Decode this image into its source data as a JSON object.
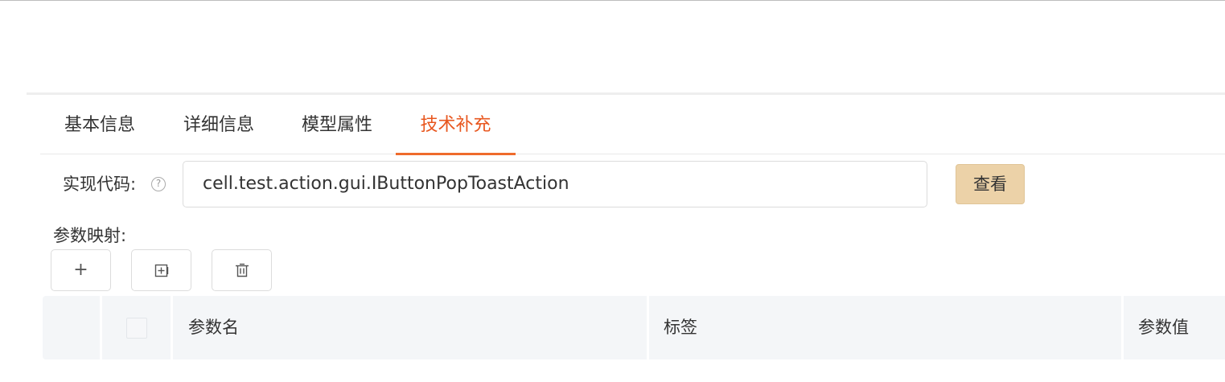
{
  "tabs": [
    {
      "label": "基本信息",
      "active": false
    },
    {
      "label": "详细信息",
      "active": false
    },
    {
      "label": "模型属性",
      "active": false
    },
    {
      "label": "技术补充",
      "active": true
    }
  ],
  "implementation": {
    "label": "实现代码:",
    "help_icon": "question-circle-icon",
    "value": "cell.test.action.gui.IButtonPopToastAction",
    "view_button": "查看"
  },
  "param_mapping": {
    "label": "参数映射:",
    "toolbar": {
      "add_label": "+",
      "add_icon": "plus-icon",
      "expand_icon": "plus-square-icon",
      "delete_icon": "trash-icon"
    },
    "table": {
      "columns": [
        "参数名",
        "标签",
        "参数值"
      ]
    }
  },
  "colors": {
    "accent": "#e8571f",
    "view_button_bg": "#ecd2a8",
    "header_bg": "#f4f6f8"
  }
}
